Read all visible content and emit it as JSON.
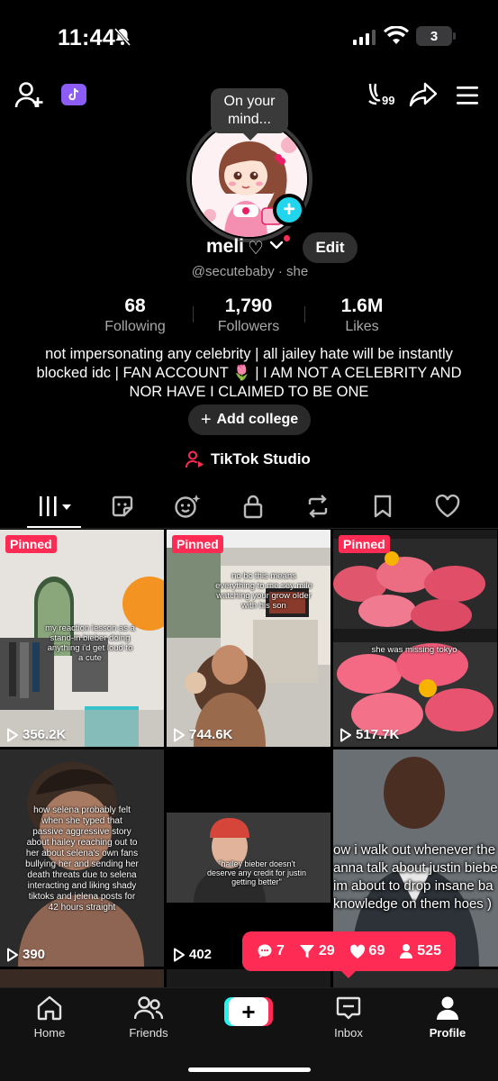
{
  "status_bar": {
    "time": "11:44",
    "battery": "3"
  },
  "top_nav": {
    "rank_badge": "99"
  },
  "avatar": {
    "bubble_text": "On your\nmind..."
  },
  "profile": {
    "username": "meli",
    "username_suffix": "♡",
    "edit_label": "Edit",
    "handle": "@secutebaby",
    "pronouns": "· she"
  },
  "stats": {
    "following": {
      "value": "68",
      "label": "Following"
    },
    "followers": {
      "value": "1,790",
      "label": "Followers"
    },
    "likes": {
      "value": "1.6M",
      "label": "Likes"
    }
  },
  "bio": "not impersonating any celebrity | all jailey hate will be instantly blocked idc | FAN ACCOUNT 🌷 | I AM NOT A CELEBRITY AND NOR HAVE I CLAIMED TO BE ONE",
  "add_college_label": "Add college",
  "studio_label": "TikTok Studio",
  "videos": [
    {
      "pinned": "Pinned",
      "views": "356.2K",
      "caption": "my reaction lesson as a stand-in bieber doing anything i'd get loud to a cute"
    },
    {
      "pinned": "Pinned",
      "views": "744.6K",
      "caption": "no bc this means everything to me sey mile watching your grow older with his son"
    },
    {
      "pinned": "Pinned",
      "views": "517.7K",
      "caption": "she was missing tokyo"
    },
    {
      "views": "390",
      "caption": "how selena probably felt when she typed that passive aggressive story about hailey reaching out to her about selena's own fans bullying her and sending her death threats due to selena interacting and liking shady tiktoks and jelena posts for 42 hours straight"
    },
    {
      "views": "402",
      "caption": "\"hailey bieber doesn't deserve any credit for justin getting better\""
    },
    {
      "caption_lines": [
        "ow i walk out whenever the",
        "anna talk about justin biebe",
        "im about to drop insane ba",
        "knowledge on them hoes )"
      ]
    }
  ],
  "activity": {
    "comments": "7",
    "shares": "29",
    "likes": "69",
    "followers": "525"
  },
  "bottom_nav": {
    "home": "Home",
    "friends": "Friends",
    "inbox": "Inbox",
    "profile": "Profile"
  },
  "colors": {
    "accent": "#fe2c55",
    "cyan": "#25f4ee",
    "badge_purple": "#8b5cf6"
  }
}
